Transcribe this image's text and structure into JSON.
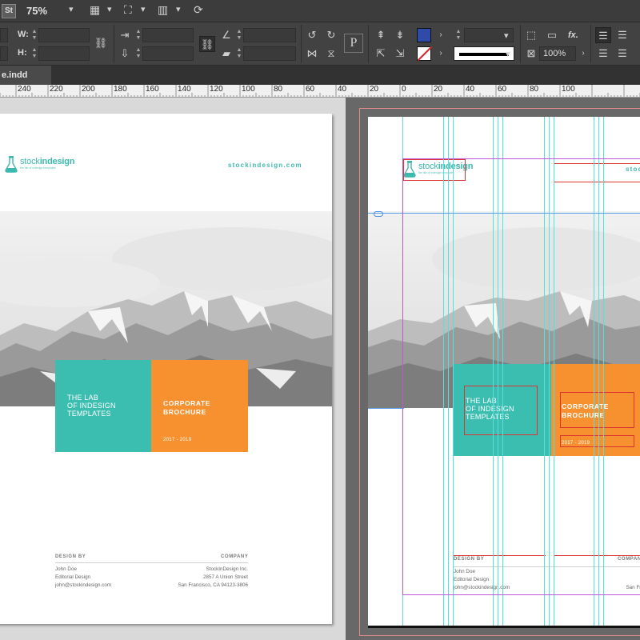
{
  "app": {
    "logo": "St",
    "zoom": "75%",
    "icons": [
      "chevron-down-icon",
      "frame-grid-icon",
      "screen-mode-icon",
      "arrange-docs-icon",
      "sync-icon"
    ]
  },
  "control_panel": {
    "w_label": "W:",
    "h_label": "H:",
    "zoom_percent": "100%",
    "fx_label": "fx.",
    "fill_color": "#2f4aa8",
    "stroke_color": "#d42828"
  },
  "document": {
    "tab_name": "e.indd"
  },
  "ruler": {
    "labels": [
      "240",
      "220",
      "200",
      "180",
      "160",
      "140",
      "120",
      "100",
      "80",
      "60",
      "40",
      "20",
      "0",
      "20",
      "40",
      "60",
      "80",
      "100"
    ]
  },
  "brochure": {
    "brand_name_light": "stock",
    "brand_name_bold": "indesign",
    "brand_tagline": "the lab of indesign templates",
    "website": "stockindesign.com",
    "teal_lines": [
      "THE LAB",
      "OF INDESIGN",
      "TEMPLATES"
    ],
    "orange_title_lines": [
      "CORPORATE",
      "BROCHURE"
    ],
    "years": "2017 - 2019",
    "design_by_label": "DESIGN BY",
    "company_label": "COMPANY",
    "designer": [
      "John Doe",
      "Editorial Design",
      "john@stockindesign.com"
    ],
    "company": [
      "StockInDesign Inc.",
      "2857 A Union Street",
      "San Francisco, CA 94123-3806"
    ]
  },
  "colors": {
    "teal": "#3bbdb0",
    "orange": "#f7902e",
    "guide": "#55e0e0",
    "margin": "#c055d8",
    "frame": "#dd3333"
  }
}
